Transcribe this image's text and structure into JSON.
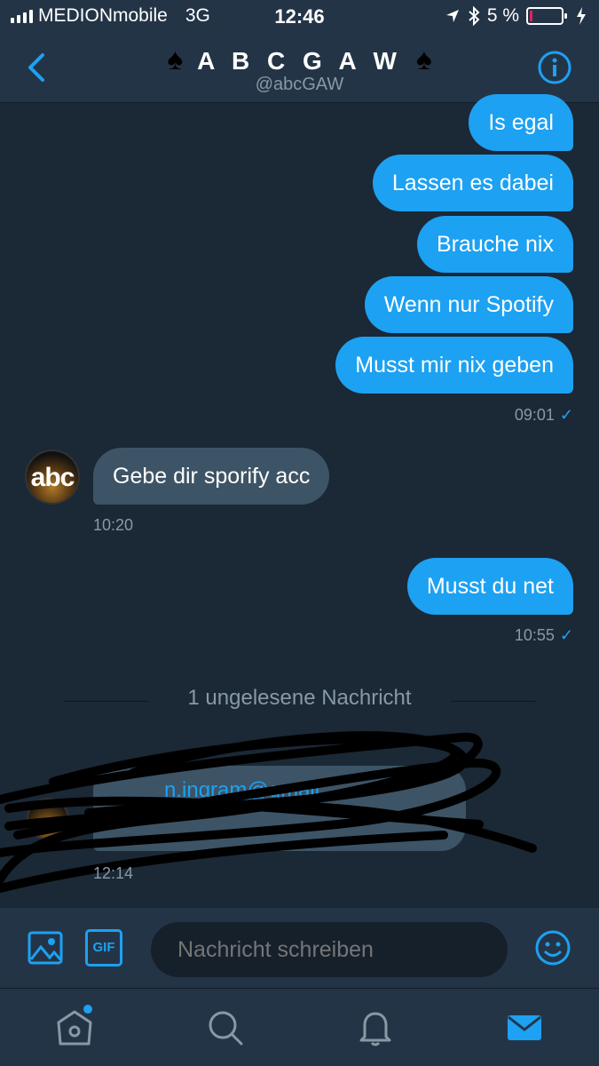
{
  "status_bar": {
    "carrier": "MEDIONmobile",
    "network": "3G",
    "time": "12:46",
    "battery": "5 %"
  },
  "header": {
    "title": "A B C G A W",
    "spade_left": "♠",
    "spade_right": "♠",
    "handle": "@abcGAW"
  },
  "messages": [
    {
      "direction": "out",
      "text": "Is egal"
    },
    {
      "direction": "out",
      "text": "Lassen es dabei"
    },
    {
      "direction": "out",
      "text": "Brauche nix"
    },
    {
      "direction": "out",
      "text": "Wenn nur Spotify"
    },
    {
      "direction": "out",
      "text": "Musst mir nix geben"
    },
    {
      "direction": "meta",
      "text": "09:01"
    },
    {
      "direction": "in",
      "text": "Gebe dir sporify acc"
    },
    {
      "direction": "meta",
      "text": "10:20"
    },
    {
      "direction": "out",
      "text": "Musst du net"
    },
    {
      "direction": "meta",
      "text": "10:55"
    },
    {
      "direction": "in",
      "text": "[redacted]"
    },
    {
      "direction": "meta",
      "text": "12:14"
    }
  ],
  "avatar_text": "abc",
  "unread_divider": "1 ungelesene Nachricht",
  "redacted_fragment": "n.ingram@gmail",
  "composer": {
    "placeholder": "Nachricht schreiben",
    "gif_label": "GIF"
  },
  "colors": {
    "accent": "#1da1f2",
    "background": "#1b2836",
    "bar": "#243447",
    "incoming_bubble": "#3d5466",
    "muted_text": "#8899a6"
  },
  "tabs": [
    "home-icon",
    "search-icon",
    "bell-icon",
    "mail-icon"
  ]
}
